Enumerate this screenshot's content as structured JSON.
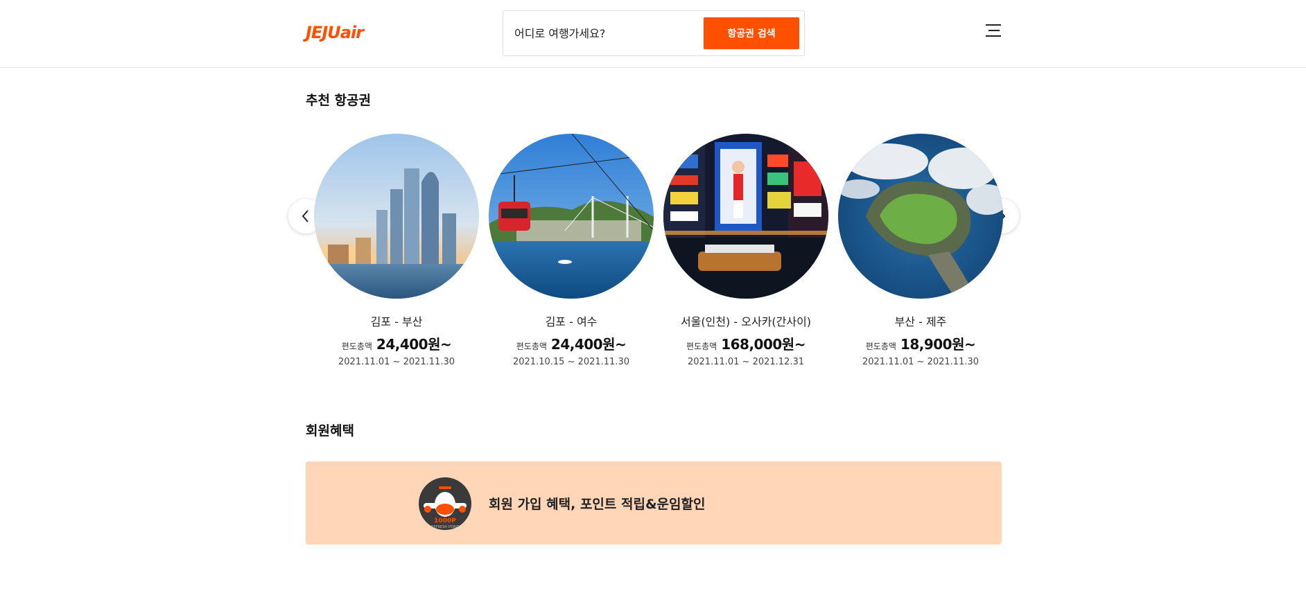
{
  "header": {
    "logo_text": "JEJU",
    "logo_text_air": "air",
    "search_placeholder": "어디로 여행가세요?",
    "search_button": "항공권 검색",
    "menu_icon": "hamburger-menu-icon",
    "accent_color": "#ff5000"
  },
  "recommend": {
    "title": "추천 항공권",
    "prev_icon": "chevron-left-icon",
    "next_icon": "chevron-right-icon",
    "cards": [
      {
        "route": "김포 - 부산",
        "price_label": "편도총액",
        "price": "24,400원~",
        "period": "2021.11.01 ~ 2021.11.30",
        "image": "busan-skyline-photo"
      },
      {
        "route": "김포 - 여수",
        "price_label": "편도총액",
        "price": "24,400원~",
        "period": "2021.10.15 ~ 2021.11.30",
        "image": "yeosu-cable-car-photo"
      },
      {
        "route": "서울(인천) - 오사카(간사이)",
        "price_label": "편도총액",
        "price": "168,000원~",
        "period": "2021.11.01 ~ 2021.12.31",
        "image": "osaka-dotonbori-photo"
      },
      {
        "route": "부산 - 제주",
        "price_label": "편도총액",
        "price": "18,900원~",
        "period": "2021.11.01 ~ 2021.11.30",
        "image": "jeju-seongsan-photo"
      }
    ]
  },
  "benefits": {
    "title": "회원혜택",
    "banner_text": "회원 가입 혜택, 포인트 적립&운임할인",
    "badge_icon": "airplane-point-badge-icon",
    "badge_text": "1000P",
    "badge_subtext": "REFRESH POINT",
    "banner_color": "#ffd6b8"
  }
}
